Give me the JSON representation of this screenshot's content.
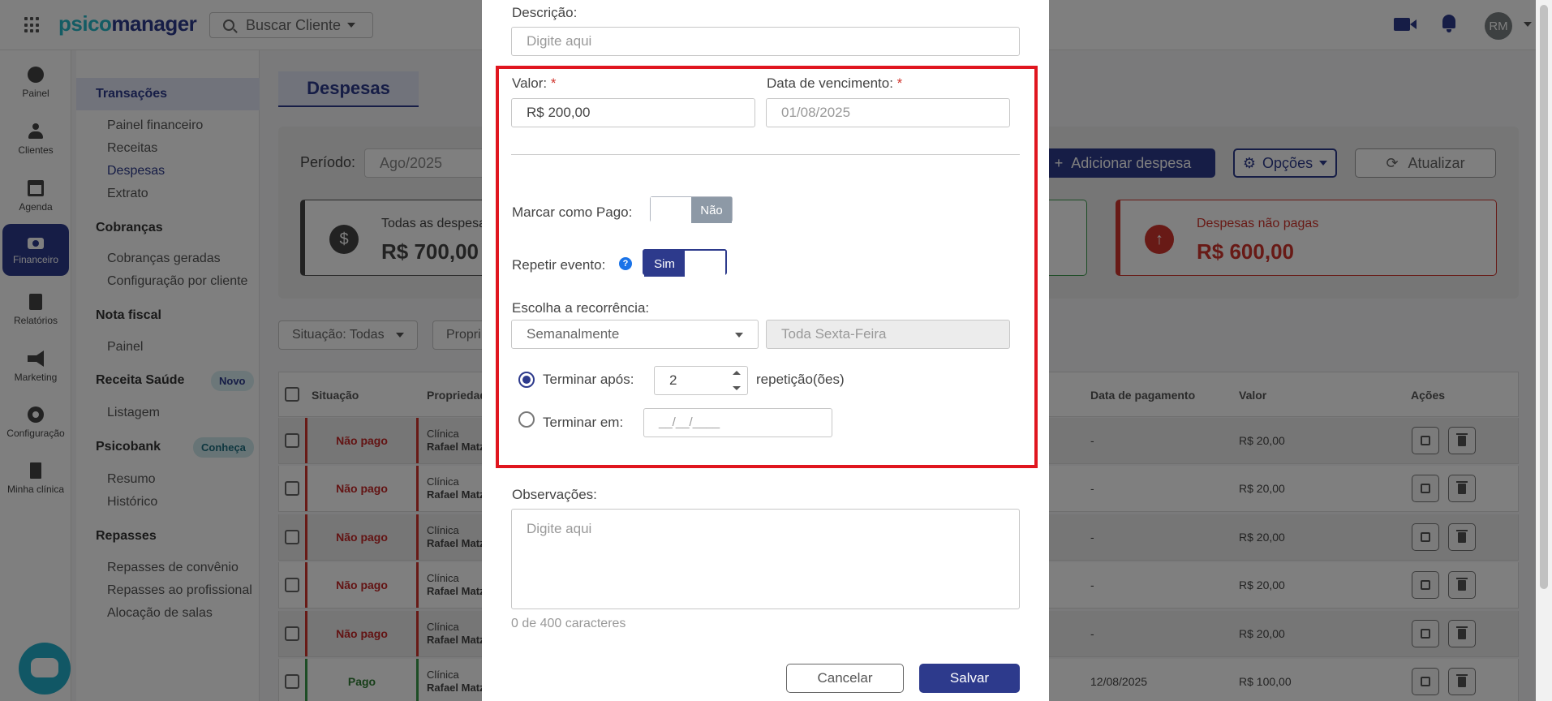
{
  "header": {
    "logo_part1": "psico",
    "logo_part2": "manager",
    "search_label": "Buscar Cliente",
    "avatar_initials": "RM"
  },
  "sidebar": {
    "items": [
      {
        "label": "Painel",
        "icon": "dashboard-icon"
      },
      {
        "label": "Clientes",
        "icon": "users-icon"
      },
      {
        "label": "Agenda",
        "icon": "calendar-icon"
      },
      {
        "label": "Financeiro",
        "icon": "money-icon",
        "active": true
      },
      {
        "label": "Relatórios",
        "icon": "file-icon"
      },
      {
        "label": "Marketing",
        "icon": "megaphone-icon"
      },
      {
        "label": "Configuração",
        "icon": "gear-icon"
      },
      {
        "label": "Minha clínica",
        "icon": "building-icon"
      }
    ]
  },
  "submenu": {
    "transacoes": "Transações",
    "transacoes_links": [
      "Painel financeiro",
      "Receitas",
      "Despesas",
      "Extrato"
    ],
    "cobrancas": "Cobranças",
    "cobrancas_links": [
      "Cobranças geradas",
      "Configuração por cliente"
    ],
    "nota_fiscal": "Nota fiscal",
    "nota_fiscal_links": [
      "Painel"
    ],
    "receita_saude": "Receita Saúde",
    "receita_saude_badge": "Novo",
    "receita_saude_links": [
      "Listagem"
    ],
    "psicobank": "Psicobank",
    "psicobank_badge": "Conheça",
    "psicobank_links": [
      "Resumo",
      "Histórico"
    ],
    "repasses": "Repasses",
    "repasses_links": [
      "Repasses de convênio",
      "Repasses ao profissional",
      "Alocação de salas"
    ]
  },
  "page": {
    "tab_title": "Despesas",
    "periodo_label": "Período:",
    "periodo_value": "Ago/2025",
    "add_button": "Adicionar despesa",
    "options_button": "Opções",
    "refresh_button": "Atualizar",
    "card_all_title": "Todas as despesas",
    "card_all_value": "R$ 700,00",
    "card_unpaid_title": "Despesas não pagas",
    "card_unpaid_value": "R$ 600,00",
    "filter_situacao": "Situação: Todas",
    "filter_propriedade": "Propri"
  },
  "table": {
    "headers": {
      "situacao": "Situação",
      "propriedade": "Propriedade",
      "data_pagamento": "Data de pagamento",
      "valor": "Valor",
      "acoes": "Ações"
    },
    "rows": [
      {
        "status": "Não pago",
        "prop1": "Clínica",
        "prop2": "Rafael Matz",
        "pay_date": "-",
        "value": "R$ 20,00"
      },
      {
        "status": "Não pago",
        "prop1": "Clínica",
        "prop2": "Rafael Matz",
        "pay_date": "-",
        "value": "R$ 20,00"
      },
      {
        "status": "Não pago",
        "prop1": "Clínica",
        "prop2": "Rafael Matz",
        "pay_date": "-",
        "value": "R$ 20,00"
      },
      {
        "status": "Não pago",
        "prop1": "Clínica",
        "prop2": "Rafael Matz",
        "pay_date": "-",
        "value": "R$ 20,00"
      },
      {
        "status": "Não pago",
        "prop1": "Clínica",
        "prop2": "Rafael Matz",
        "pay_date": "-",
        "value": "R$ 20,00"
      },
      {
        "status": "Pago",
        "prop1": "Clínica",
        "prop2": "Rafael Matz",
        "pay_date": "12/08/2025",
        "value": "R$ 100,00"
      }
    ]
  },
  "modal": {
    "descricao_label": "Descrição:",
    "descricao_placeholder": "Digite aqui",
    "valor_label": "Valor:",
    "valor_value": "R$ 200,00",
    "vencimento_label": "Data de vencimento:",
    "vencimento_value": "01/08/2025",
    "required_mark": "*",
    "marcar_pago_label": "Marcar como Pago:",
    "marcar_pago_state": "Não",
    "repetir_label": "Repetir evento:",
    "repetir_state": "Sim",
    "help_glyph": "?",
    "recorrencia_label": "Escolha a recorrência:",
    "recorrencia_value": "Semanalmente",
    "recorrencia_day": "Toda Sexta-Feira",
    "terminar_apos_label": "Terminar após:",
    "terminar_apos_value": "2",
    "repeticoes_label": "repetição(ões)",
    "terminar_em_label": "Terminar em:",
    "terminar_em_placeholder": "__/__/____",
    "observacoes_label": "Observações:",
    "observacoes_placeholder": "Digite aqui",
    "counter": "0 de 400 caracteres",
    "cancel_button": "Cancelar",
    "save_button": "Salvar"
  },
  "colors": {
    "primary": "#2d3a8c",
    "brand_teal": "#28b9c9",
    "highlight": "#e0161f",
    "unpaid": "#d0342c",
    "paid": "#3b9b4b"
  }
}
